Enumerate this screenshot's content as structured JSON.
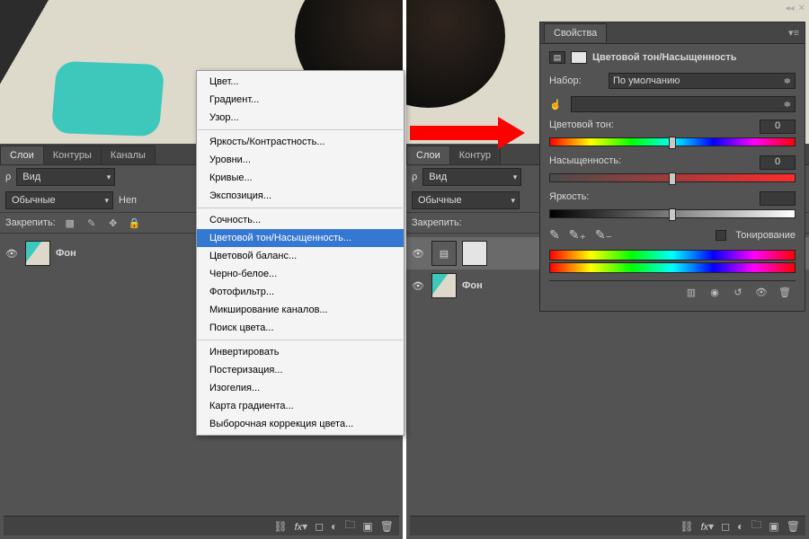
{
  "left": {
    "tabs": {
      "layers": "Слои",
      "paths": "Контуры",
      "channels": "Каналы"
    },
    "filter": {
      "kind": "Вид"
    },
    "blend": {
      "mode": "Обычные",
      "opacity_label": "Неп"
    },
    "lock_label": "Закрепить:",
    "layer": {
      "bg_name": "Фон"
    }
  },
  "right": {
    "tabs": {
      "layers": "Слои",
      "paths": "Контур"
    },
    "filter": {
      "kind": "Вид"
    },
    "blend": {
      "mode": "Обычные"
    },
    "lock_label": "Закрепить:",
    "layer": {
      "adj_name": "",
      "bg_name": "Фон"
    }
  },
  "menu": {
    "items_a": [
      "Цвет...",
      "Градиент...",
      "Узор..."
    ],
    "items_b": [
      "Яркость/Контрастность...",
      "Уровни...",
      "Кривые...",
      "Экспозиция..."
    ],
    "items_c": [
      "Сочность...",
      "Цветовой тон/Насыщенность...",
      "Цветовой баланс...",
      "Черно-белое...",
      "Фотофильтр...",
      "Микширование каналов...",
      "Поиск цвета..."
    ],
    "items_d": [
      "Инвертировать",
      "Постеризация...",
      "Изогелия...",
      "Карта градиента...",
      "Выборочная коррекция цвета..."
    ],
    "highlighted": "Цветовой тон/Насыщенность..."
  },
  "properties": {
    "panel_title": "Свойства",
    "adj_title": "Цветовой тон/Насыщенность",
    "preset_label": "Набор:",
    "preset_value": "По умолчанию",
    "channel_value": "",
    "hue_label": "Цветовой тон:",
    "sat_label": "Насыщенность:",
    "light_label": "Яркость:",
    "hue_value": "0",
    "sat_value": "0",
    "light_value": "",
    "colorize_label": "Тонирование"
  },
  "chart_data": {
    "type": "table",
    "title": "Hue/Saturation adjustment sliders",
    "series": [
      {
        "name": "Цветовой тон",
        "value": 0,
        "range": [
          -180,
          180
        ]
      },
      {
        "name": "Насыщенность",
        "value": 0,
        "range": [
          -100,
          100
        ]
      },
      {
        "name": "Яркость",
        "value": 0,
        "range": [
          -100,
          100
        ]
      }
    ],
    "colorize": false,
    "preset": "По умолчанию"
  }
}
